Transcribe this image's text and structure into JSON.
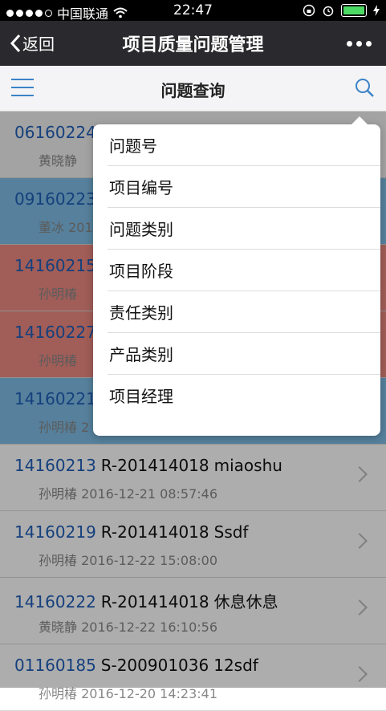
{
  "status_bar": {
    "carrier": "中国联通",
    "time": "22:47"
  },
  "nav": {
    "back_label": "返回",
    "title": "项目质量问题管理"
  },
  "toolbar": {
    "title": "问题查询"
  },
  "list": [
    {
      "id": "06160224",
      "code": "",
      "desc": "",
      "meta": "黄晓静",
      "color": "grey"
    },
    {
      "id": "09160223",
      "code": "",
      "desc": "",
      "meta": "董冰 201",
      "color": "blue"
    },
    {
      "id": "14160215",
      "code": "",
      "desc": "",
      "meta": "孙明椿",
      "color": "red"
    },
    {
      "id": "14160227",
      "code": "",
      "desc": "",
      "meta": "孙明椿",
      "color": "red"
    },
    {
      "id": "14160221",
      "code": "",
      "desc": "",
      "meta": "孙明椿 2",
      "color": "blue"
    },
    {
      "id": "14160213",
      "code": "R-201414018",
      "desc": "miaoshu",
      "meta": "孙明椿 2016-12-21 08:57:46",
      "color": "white"
    },
    {
      "id": "14160219",
      "code": "R-201414018",
      "desc": "Ssdf",
      "meta": "孙明椿 2016-12-22 15:08:00",
      "color": "white"
    },
    {
      "id": "14160222",
      "code": "R-201414018",
      "desc": "休息休息",
      "meta": "黄晓静 2016-12-22 16:10:56",
      "color": "white"
    },
    {
      "id": "01160185",
      "code": "S-200901036",
      "desc": "12sdf",
      "meta": "孙明椿 2016-12-20 14:23:41",
      "color": "white"
    }
  ],
  "popup_menu": [
    "问题号",
    "项目编号",
    "问题类别",
    "项目阶段",
    "责任类别",
    "产品类别",
    "项目经理"
  ]
}
